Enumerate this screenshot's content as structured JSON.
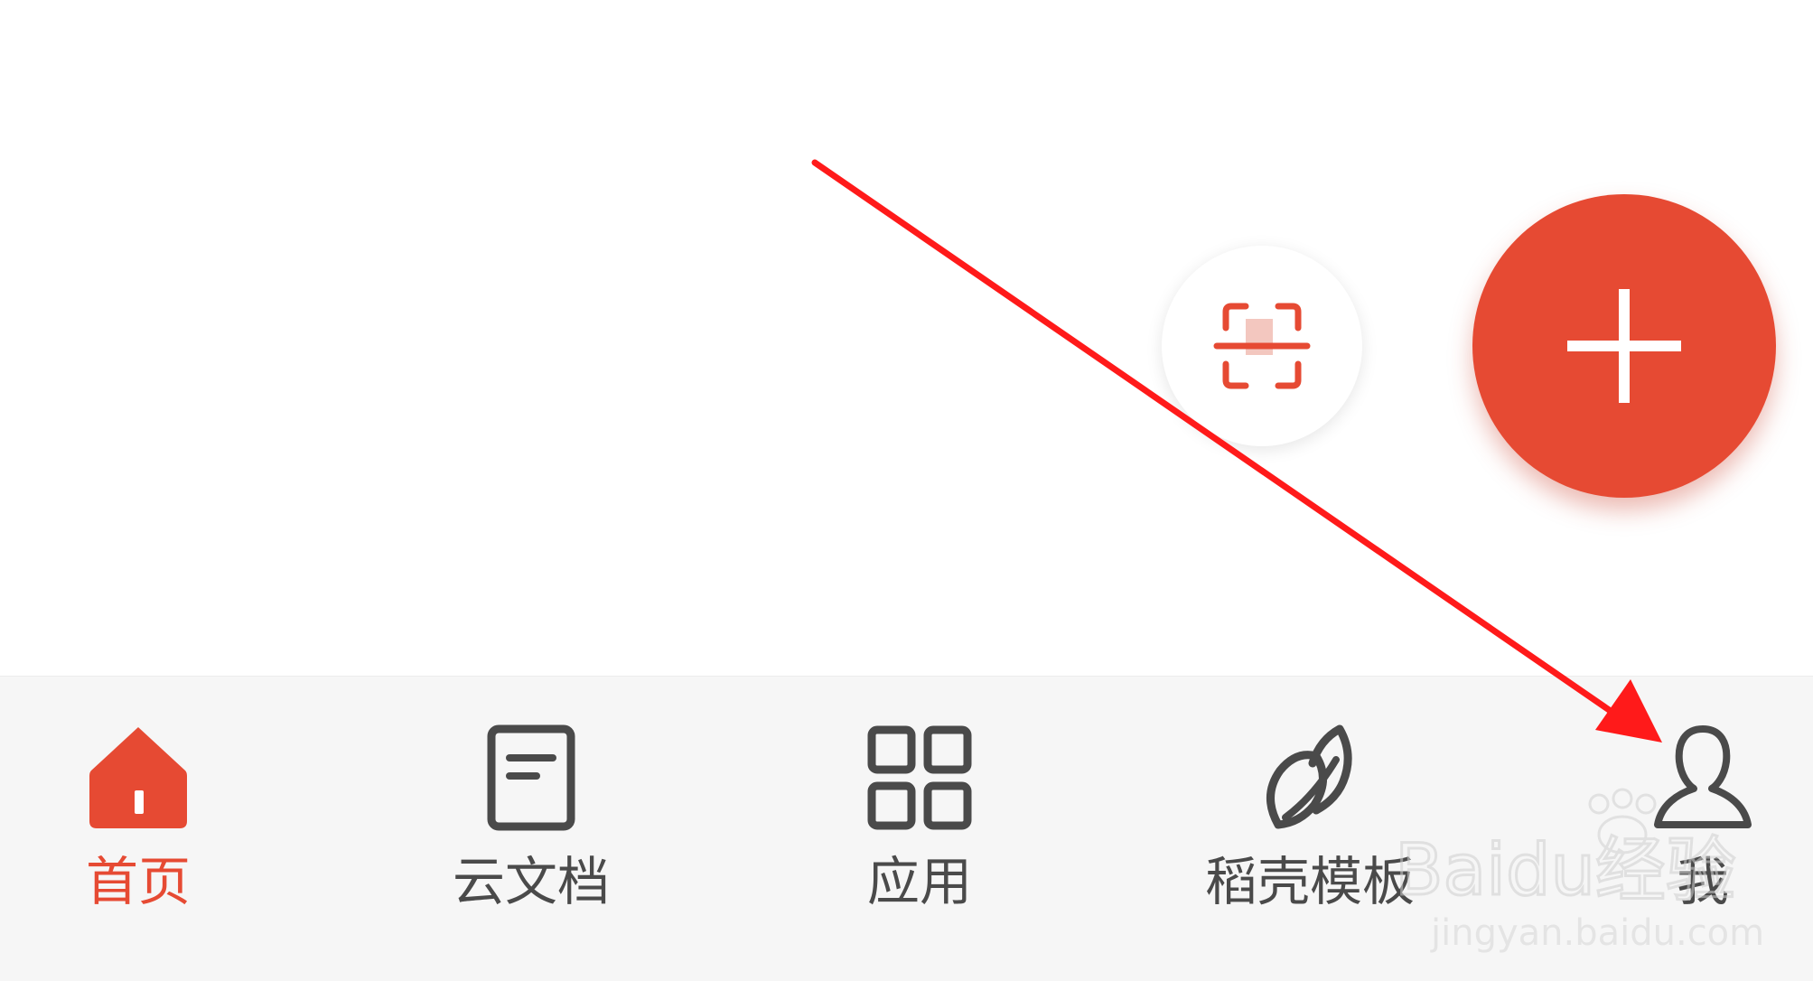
{
  "colors": {
    "accent": "#e64a33",
    "nav_background": "#f6f6f6",
    "icon_inactive": "#4a4a4a",
    "annotation_arrow": "#ff1a1a"
  },
  "floating_actions": {
    "scan": {
      "icon": "scan-document-icon"
    },
    "add": {
      "icon": "plus-icon"
    }
  },
  "bottom_nav": {
    "items": [
      {
        "label": "首页",
        "icon": "home-icon",
        "active": true
      },
      {
        "label": "云文档",
        "icon": "document-icon",
        "active": false
      },
      {
        "label": "应用",
        "icon": "grid-apps-icon",
        "active": false
      },
      {
        "label": "稻壳模板",
        "icon": "leaf-icon",
        "active": false
      },
      {
        "label": "我",
        "icon": "person-icon",
        "active": false
      }
    ]
  },
  "watermark": {
    "brand": "Baidu经验",
    "url": "jingyan.baidu.com"
  }
}
